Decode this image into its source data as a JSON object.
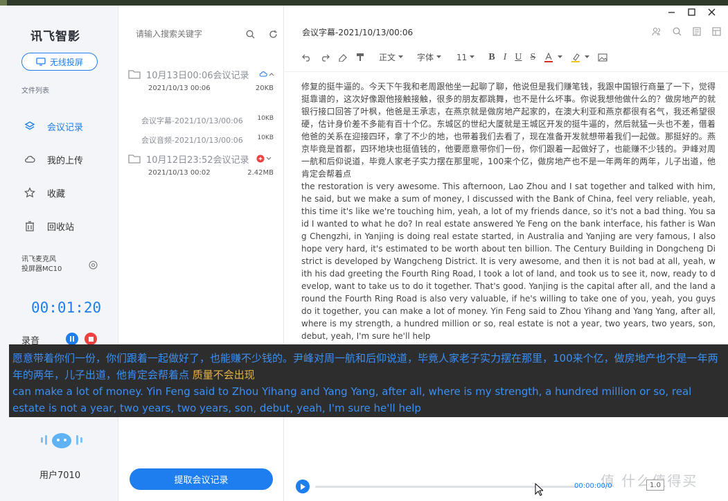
{
  "app": {
    "logo": "讯飞智影",
    "cast_button": "无线投屏",
    "file_list_label": "文件列表"
  },
  "nav": [
    {
      "label": "会议记录",
      "icon": "layers-icon",
      "active": true
    },
    {
      "label": "我的上传",
      "icon": "cloud-icon",
      "active": false
    },
    {
      "label": "收藏",
      "icon": "star-icon",
      "active": false
    },
    {
      "label": "回收站",
      "icon": "trash-icon",
      "active": false
    }
  ],
  "device": {
    "line1": "讯飞麦克风",
    "line2": "投屏器MC10"
  },
  "recording": {
    "timer": "00:01:20",
    "label": "录音"
  },
  "user": {
    "name": "用户7010"
  },
  "list": {
    "search_placeholder": "请输入搜索关键字",
    "records": [
      {
        "title": "10月13日00:06会议记录",
        "date": "2021/10/13 00:06",
        "size": "20KB",
        "children": [
          {
            "name": "会议字幕-2021/10/13/00:06",
            "size": "10KB"
          },
          {
            "name": "会议音频-2021/10/13/00:06",
            "size": "10KB"
          }
        ]
      },
      {
        "title": "10月12日23:52会议记录",
        "date": "2021/10/13 00:02",
        "size": "2.42MB",
        "children": []
      }
    ],
    "extract_button": "提取会议记录"
  },
  "main": {
    "title": "会议字幕-2021/10/13/00:06",
    "toolbar": {
      "paragraph": "正文",
      "font": "字体",
      "size": "11"
    },
    "content_cn": "修复的挺牛逼的。今天下午我和老周跟他坐一起聊了聊，他说但是我们赚笔钱，我跟中国银行商量了一下，觉得挺靠谱的，这次好像跟他接触接触，很多的朋友都跳舞，也不是什么坏事。你说我想他做什么的？做房地产的就银行接口回答了叶枫，他爸是王承志，在燕京就是做房地产起家的，在澳大利亚和燕京都很有名气，我还希望很硬，估计身价差不多能有百十个亿。东城区的世纪大厦就是王城区开发的挺牛逼的，然后就猛一头也不差，借着他爸的关系在迎接四环，拿了不少的地，也带着我们去看了，现在准备开发就想带着我们一起做。那挺好的。燕京毕竟是首都，四环地块也挺值钱的，他要愿意带你们一份，你们跟着一起做好了，也能赚不少钱的。尹峰对周一航和后仰说道，毕竟人家老子实力摆在那里呢，100来个亿，做房地产也不是一年两年的两年，儿子出道，他肯定会帮着点",
    "content_en": " the restoration is very awesome. This afternoon, Lao Zhou and I sat together and talked with him, he said, but we make a sum of money, I discussed with the Bank of China, feel very reliable, yeah, this time it's like we're touching him, yeah, a lot of my friends dance, so it's not a bad thing. You said I wanted to what he do? In real estate answered Ye Feng on the bank interface, his father is Wang Chengzhi, in Yanjing is doing real estate started, in Australia and Yanjing are very famous, I also hope very hard, it's estimated to be worth about ten billion. The Century Building in Dongcheng District is developed by Wangcheng District. It is very awesome, and then it is not bad at all, yeah, with his dad greeting the Fourth Ring Road, I took a lot of land, and took us to see it, now, ready to develop, want to take us to do it together. That's good. Yanjing is the capital after all, and the land around the Fourth Ring Road is also very valuable, if he's willing to take one of you, yeah, you guys do it together, you can make a lot of money. Yin Feng said to Zhou Yihang and Yang Yang, after all, where is my strength, a hundred million or so, real estate is not a year, two years, two years, son, debut, yeah, I'm sure he'll help",
    "player": {
      "time": "00:00:00/0",
      "speed": "1.0"
    }
  },
  "overlay": {
    "cn": "愿意带着你们一份，你们跟着一起做好了，也能赚不少钱的。尹峰对周一航和后仰说道，毕竟人家老子实力摆在那里，100来个亿，做房地产也不是一年两年的两年，儿子出道，他肯定会帮着点",
    "cn_hint": "质量不会出现",
    "en": "can make a lot of money. Yin Feng said to Zhou Yihang and Yang Yang, after all, where is my strength, a hundred million or so, real estate is not a year, two years, two years, son, debut, yeah, I'm sure he'll help"
  },
  "watermark": "值 什么值得买",
  "colors": {
    "accent": "#1e7ef0",
    "stop": "#f0413e",
    "overlay_text": "#3a8ff5",
    "hint": "#e3b243"
  }
}
